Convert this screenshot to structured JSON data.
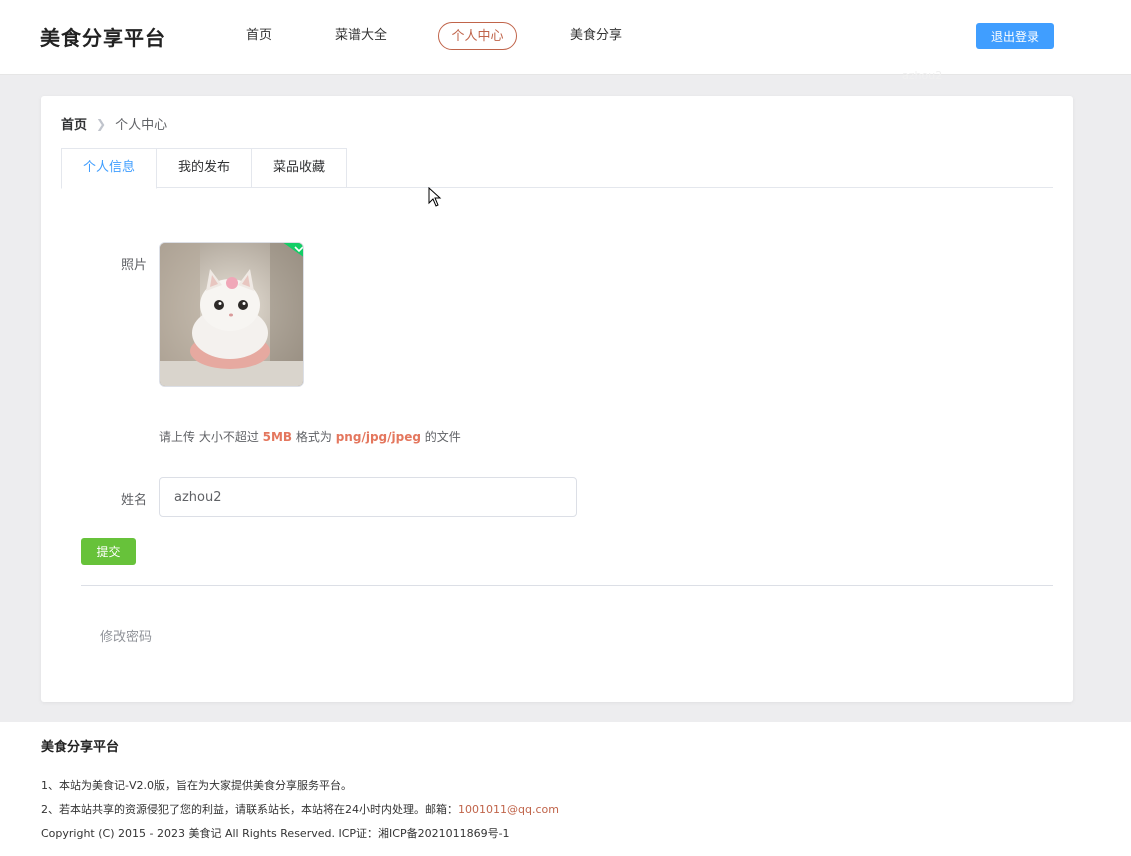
{
  "header": {
    "brand": "美食分享平台",
    "nav": [
      {
        "label": "首页",
        "active": false
      },
      {
        "label": "菜谱大全",
        "active": false
      },
      {
        "label": "个人中心",
        "active": true
      },
      {
        "label": "美食分享",
        "active": false
      }
    ],
    "logout_label": "退出登录",
    "username_ghost": "azhou2"
  },
  "breadcrumb": {
    "home": "首页",
    "current": "个人中心"
  },
  "tabs": [
    {
      "label": "个人信息",
      "active": true
    },
    {
      "label": "我的发布",
      "active": false
    },
    {
      "label": "菜品收藏",
      "active": false
    }
  ],
  "form": {
    "photo_label": "照片",
    "tip": {
      "prefix": "请上传 大小不超过 ",
      "size": "5MB",
      "middle": " 格式为 ",
      "formats": "png/jpg/jpeg",
      "suffix": " 的文件"
    },
    "name_label": "姓名",
    "name_value": "azhou2",
    "submit_label": "提交",
    "change_password_label": "修改密码"
  },
  "footer": {
    "title": "美食分享平台",
    "line1": "1、本站为美食记-V2.0版，旨在为大家提供美食分享服务平台。",
    "line2_prefix": "2、若本站共享的资源侵犯了您的利益，请联系站长，本站将在24小时内处理。邮箱：",
    "email": "1001011@qq.com",
    "copyright": "Copyright (C) 2015 - 2023 美食记 All Rights Reserved. ICP证：湘ICP备2021011869号-1"
  },
  "colors": {
    "primary": "#409eff",
    "success": "#67c23a",
    "accent": "#c0644a",
    "highlight": "#e4775e"
  },
  "icons": {
    "breadcrumb_separator": "chevron-right-icon",
    "upload_success": "check-icon",
    "cursor": "mouse-pointer-icon"
  }
}
